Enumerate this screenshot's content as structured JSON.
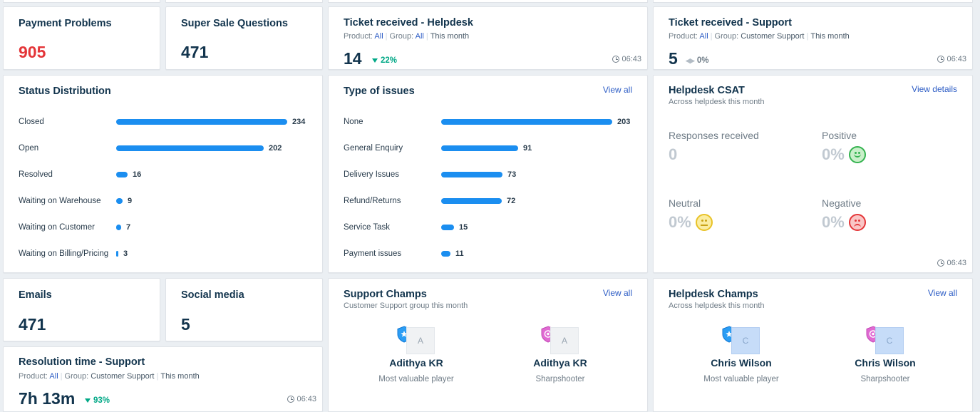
{
  "payment_problems": {
    "title": "Payment Problems",
    "value": "905"
  },
  "super_sale": {
    "title": "Super Sale Questions",
    "value": "471"
  },
  "ticket_helpdesk": {
    "title": "Ticket received - Helpdesk",
    "product_label": "Product:",
    "product_value": "All",
    "group_label": "Group:",
    "group_value": "All",
    "period": "This month",
    "value": "14",
    "trend": "22%",
    "time": "06:43"
  },
  "ticket_support": {
    "title": "Ticket received - Support",
    "product_label": "Product:",
    "product_value": "All",
    "group_label": "Group:",
    "group_value": "Customer Support",
    "period": "This month",
    "value": "5",
    "trend": "0%",
    "time": "06:43"
  },
  "status_distribution": {
    "title": "Status Distribution",
    "max": 234,
    "items": [
      {
        "label": "Closed",
        "value": 234
      },
      {
        "label": "Open",
        "value": 202
      },
      {
        "label": "Resolved",
        "value": 16
      },
      {
        "label": "Waiting on Warehouse",
        "value": 9
      },
      {
        "label": "Waiting on Customer",
        "value": 7
      },
      {
        "label": "Waiting on Billing/Pricing",
        "value": 3
      }
    ]
  },
  "type_of_issues": {
    "title": "Type of issues",
    "view_all": "View all",
    "max": 203,
    "items": [
      {
        "label": "None",
        "value": 203
      },
      {
        "label": "General Enquiry",
        "value": 91
      },
      {
        "label": "Delivery Issues",
        "value": 73
      },
      {
        "label": "Refund/Returns",
        "value": 72
      },
      {
        "label": "Service Task",
        "value": 15
      },
      {
        "label": "Payment issues",
        "value": 11
      }
    ]
  },
  "csat": {
    "title": "Helpdesk CSAT",
    "subtitle": "Across helpdesk this month",
    "view_details": "View details",
    "responses_label": "Responses received",
    "responses_value": "0",
    "positive_label": "Positive",
    "positive_value": "0%",
    "neutral_label": "Neutral",
    "neutral_value": "0%",
    "negative_label": "Negative",
    "negative_value": "0%",
    "time": "06:43"
  },
  "emails": {
    "title": "Emails",
    "value": "471"
  },
  "social_media": {
    "title": "Social media",
    "value": "5"
  },
  "resolution_time": {
    "title": "Resolution time - Support",
    "product_label": "Product:",
    "product_value": "All",
    "group_label": "Group:",
    "group_value": "Customer Support",
    "period": "This month",
    "value": "7h 13m",
    "trend": "93%",
    "time": "06:43"
  },
  "support_champs": {
    "title": "Support Champs",
    "subtitle": "Customer Support group this month",
    "view_all": "View all",
    "champs": [
      {
        "initial": "A",
        "name": "Adithya KR",
        "role": "Most valuable player",
        "badge": "star-badge-icon"
      },
      {
        "initial": "A",
        "name": "Adithya KR",
        "role": "Sharpshooter",
        "badge": "target-badge-icon"
      }
    ]
  },
  "helpdesk_champs": {
    "title": "Helpdesk Champs",
    "subtitle": "Across helpdesk this month",
    "view_all": "View all",
    "champs": [
      {
        "initial": "C",
        "name": "Chris Wilson",
        "role": "Most valuable player",
        "badge": "star-badge-icon"
      },
      {
        "initial": "C",
        "name": "Chris Wilson",
        "role": "Sharpshooter",
        "badge": "target-badge-icon"
      }
    ]
  },
  "colors": {
    "accent": "#2c5cc5",
    "bar": "#1b8ef0",
    "danger": "#e43538",
    "success": "#00a886"
  }
}
